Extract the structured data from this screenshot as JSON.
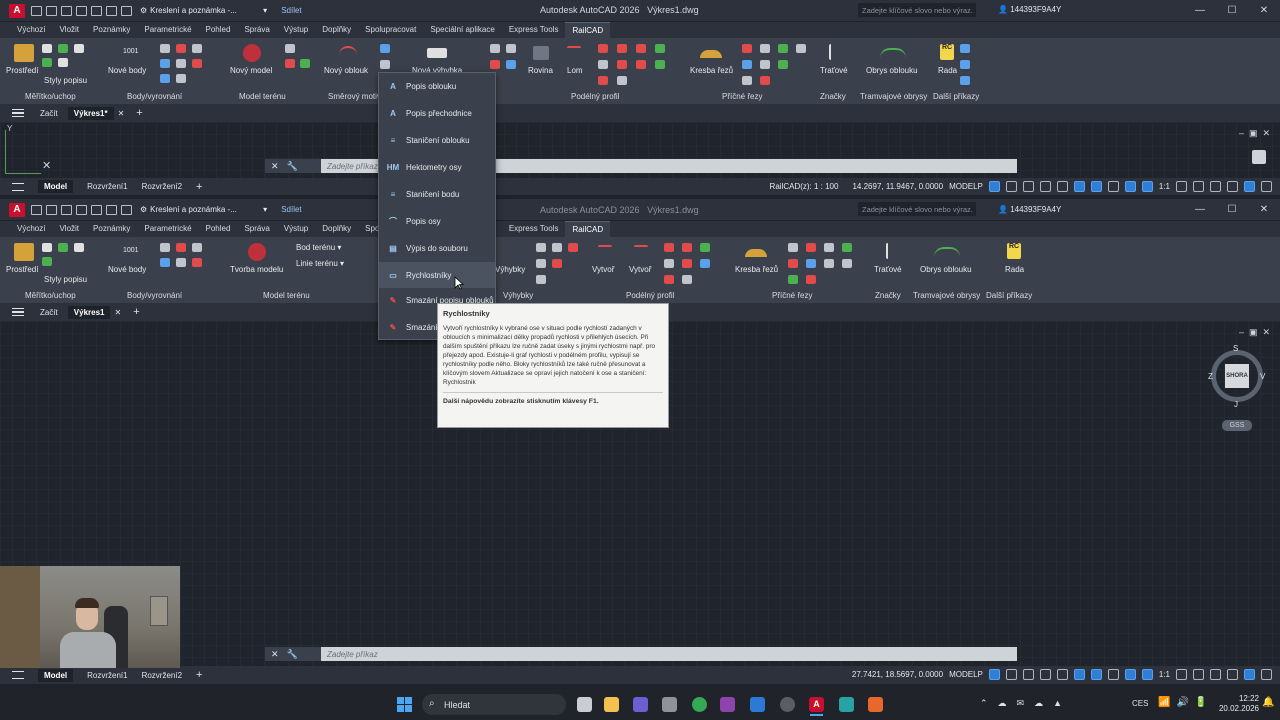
{
  "app": {
    "title": "Autodesk AutoCAD 2026",
    "file": "Výkres1.dwg",
    "workspace": "Kreslení a poznámka -...",
    "share": "Sdílet",
    "search_placeholder": "Zadejte klíčové slovo nebo výraz.",
    "user": "144393F9A4Y"
  },
  "ribbon_tabs": [
    "Výchozí",
    "Vložit",
    "Poznámky",
    "Parametrické",
    "Pohled",
    "Správa",
    "Výstup",
    "Doplňky",
    "Spolupracovat",
    "Speciální aplikace",
    "Express Tools",
    "RailCAD"
  ],
  "ribbon_top": {
    "buttons": [
      "Prostředí",
      "Nové body",
      "Nový model",
      "Nový oblouk",
      "Nová výhybka",
      "Rovina",
      "Lom",
      "Kresba řezů",
      "Traťové",
      "Obrys oblouku",
      "Rada"
    ],
    "sub": [
      "Styly popisu",
      "Bod terénu",
      "Linie terénu"
    ],
    "panels": [
      "Měřítko/uchop",
      "Body/vyrovnání",
      "Model terénu",
      "Směrový motiv",
      "Podélný profil",
      "Příčné řezy",
      "Značky",
      "Tramvajové obrysy",
      "Další příkazy"
    ]
  },
  "ribbon_bottom": {
    "buttons": [
      "Prostředí",
      "Nové body",
      "Tvorba modelu",
      "Bod terénu",
      "Linie terénu",
      "Výhybky",
      "Vytvoř",
      "Vytvoř",
      "Kresba řezů",
      "Traťové",
      "Obrys oblouku",
      "Rada"
    ],
    "sub": [
      "Styly popisu"
    ],
    "panels": [
      "Měřítko/uchop",
      "Body/vyrovnání",
      "Model terénu",
      "Výhybky",
      "Podélný profil",
      "Příčné řezy",
      "Značky",
      "Tramvajové obrysy",
      "Další příkazy"
    ]
  },
  "doc_tabs": {
    "start": "Začít",
    "top_current": "Výkres1*",
    "bottom_current": "Výkres1"
  },
  "command": {
    "placeholder": "Zadejte příkaz"
  },
  "status_top": {
    "layouts": [
      "Model",
      "Rozvržení1",
      "Rozvržení2"
    ],
    "railcad": "RailCAD(z): 1 : 100",
    "coords": "14.2697, 11.9467, 0.0000",
    "space": "MODELP",
    "scale": "1:1"
  },
  "status_bottom": {
    "layouts": [
      "Model",
      "Rozvržení1",
      "Rozvržení2"
    ],
    "coords": "27.7421, 18.5697, 0.0000",
    "space": "MODELP",
    "scale": "1:1"
  },
  "dropdown": {
    "items": [
      {
        "label": "Popis oblouku",
        "icon": "A"
      },
      {
        "label": "Popis přechodnice",
        "icon": "A"
      },
      {
        "label": "Staničení oblouku",
        "icon": "≡"
      },
      {
        "label": "Hektometry osy",
        "icon": "HM"
      },
      {
        "label": "Staničení bodu",
        "icon": "≡"
      },
      {
        "label": "Popis osy",
        "icon": "⌒"
      },
      {
        "label": "Výpis do souboru",
        "icon": "▤"
      },
      {
        "label": "Rychlostníky",
        "icon": "▭"
      },
      {
        "label": "Smazání popisu oblouků",
        "icon": "✎"
      },
      {
        "label": "Smazání",
        "icon": "✎"
      }
    ]
  },
  "tooltip": {
    "title": "Rychlostníky",
    "body": "Vytvoří rychlostníky k vybrané ose v situaci podle rychlostí zadaných v obloucích s minimalizací délky propadů rychlosti v přilehlých úsecích. Při dalším spuštění příkazu lze ručně zadat úseky s jinými rychlostmi např. pro přejezdy apod. Existuje-li graf rychlosti v podélném profilu, vypisují se rychlostníky podle něho. Bloky rychlostníků lze také ručně přesunovat a klíčovým slovem Aktualizace se opraví jejich natočení k ose a staničení: Rychlostnik",
    "footer": "Další nápovědu zobrazíte stisknutím klávesy F1."
  },
  "viewcube": {
    "n": "S",
    "s": "J",
    "e": "V",
    "w": "Z",
    "face": "SHORA",
    "wcs": "GSS"
  },
  "taskbar": {
    "search": "Hledat",
    "lang": "CES",
    "time": "12:22",
    "date": "20.02.2026"
  }
}
